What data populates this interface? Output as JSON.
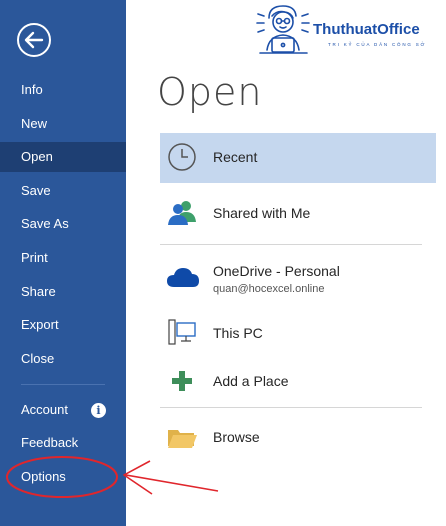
{
  "sidebar": {
    "items": [
      {
        "label": "Info"
      },
      {
        "label": "New"
      },
      {
        "label": "Open"
      },
      {
        "label": "Save"
      },
      {
        "label": "Save As"
      },
      {
        "label": "Print"
      },
      {
        "label": "Share"
      },
      {
        "label": "Export"
      },
      {
        "label": "Close"
      },
      {
        "label": "Account"
      },
      {
        "label": "Feedback"
      },
      {
        "label": "Options"
      }
    ],
    "active": "Open"
  },
  "main": {
    "title": "Open",
    "locations": [
      {
        "label": "Recent"
      },
      {
        "label": "Shared with Me"
      },
      {
        "label": "OneDrive - Personal",
        "sublabel": "quan@hocexcel.online"
      },
      {
        "label": "This PC"
      },
      {
        "label": "Add a Place"
      },
      {
        "label": "Browse"
      }
    ]
  },
  "watermark": {
    "title": "ThuthuatOffice",
    "subtitle": "TRI KỶ CỦA DÂN CÔNG SỞ"
  },
  "colors": {
    "sidebar": "#2b579a",
    "sidebar_active": "#1e3f73",
    "location_active": "#c5d7ee",
    "annotation": "#e0262c"
  }
}
